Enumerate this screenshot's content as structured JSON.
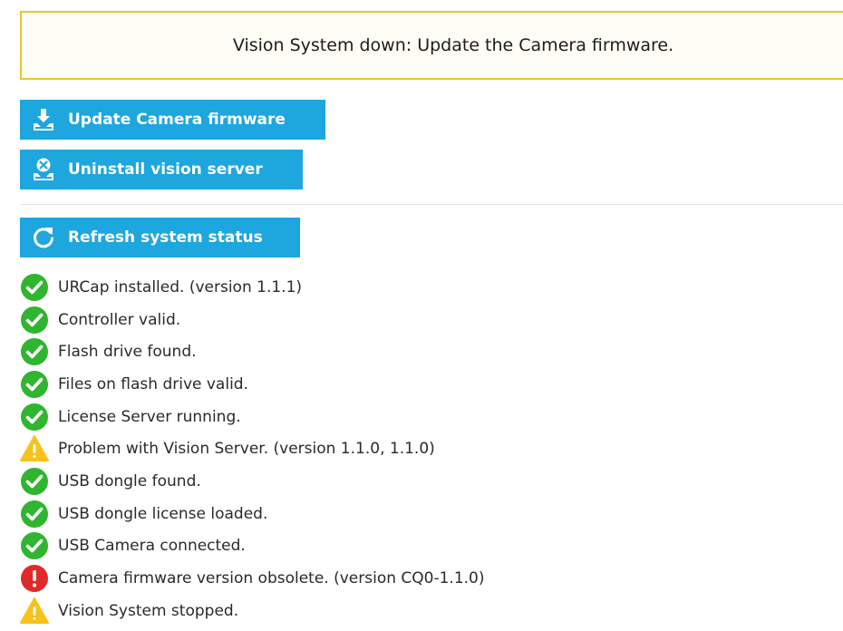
{
  "banner": {
    "message": "Vision System down: Update the Camera firmware.",
    "border_color": "#e4c92e"
  },
  "buttons": {
    "update_firmware": {
      "label": "Update Camera firmware",
      "icon": "download-drive-icon"
    },
    "uninstall_server": {
      "label": "Uninstall vision server",
      "icon": "remove-drive-icon"
    },
    "refresh_status": {
      "label": "Refresh system status",
      "icon": "refresh-icon"
    },
    "color": "#1ea6de"
  },
  "status_colors": {
    "ok": "#2fb52f",
    "warning": "#f7c21b",
    "error": "#e02a2a"
  },
  "status_items": [
    {
      "status": "ok",
      "text": "URCap installed. (version 1.1.1)"
    },
    {
      "status": "ok",
      "text": "Controller valid."
    },
    {
      "status": "ok",
      "text": "Flash drive found."
    },
    {
      "status": "ok",
      "text": "Files on flash drive valid."
    },
    {
      "status": "ok",
      "text": "License Server running."
    },
    {
      "status": "warning",
      "text": "Problem with Vision Server. (version 1.1.0, 1.1.0)"
    },
    {
      "status": "ok",
      "text": "USB dongle found."
    },
    {
      "status": "ok",
      "text": "USB dongle license loaded."
    },
    {
      "status": "ok",
      "text": "USB Camera connected."
    },
    {
      "status": "error",
      "text": "Camera firmware version obsolete. (version CQ0-1.1.0)"
    },
    {
      "status": "warning",
      "text": "Vision System stopped."
    }
  ]
}
